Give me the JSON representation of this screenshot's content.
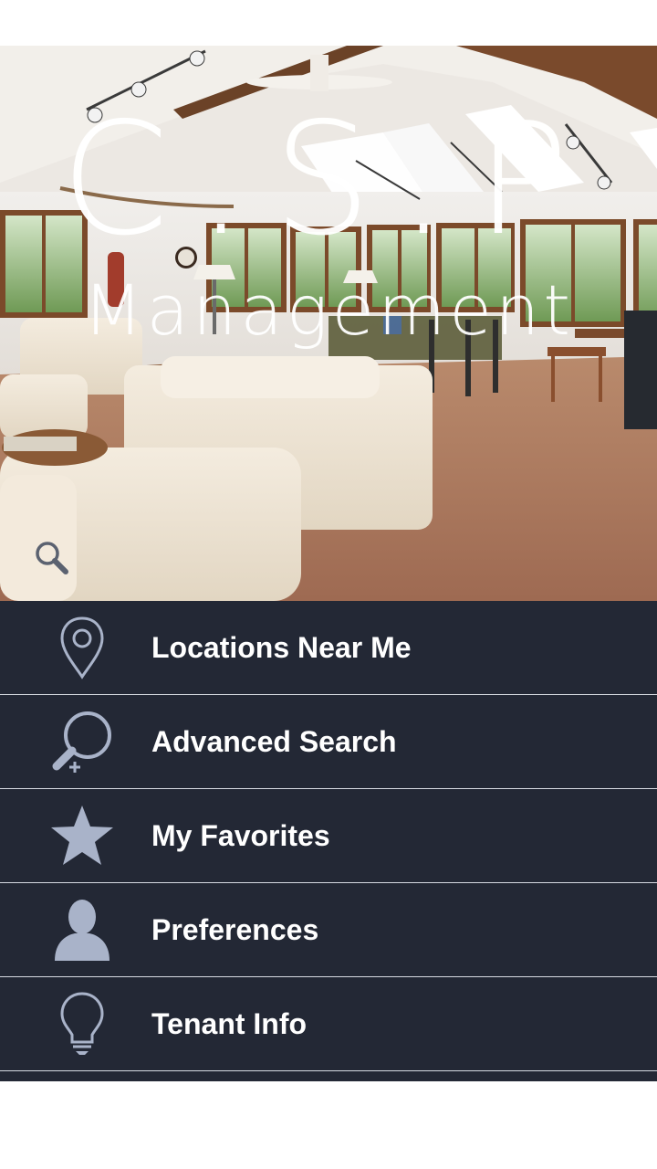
{
  "app": {
    "logo_mark": "C.S.P",
    "logo_subtitle": "Management"
  },
  "hero": {
    "search_icon": "search-icon"
  },
  "menu": {
    "items": [
      {
        "label": "Locations Near Me",
        "icon": "location-pin-icon"
      },
      {
        "label": "Advanced Search",
        "icon": "advanced-search-icon"
      },
      {
        "label": "My Favorites",
        "icon": "star-icon"
      },
      {
        "label": "Preferences",
        "icon": "user-icon"
      },
      {
        "label": "Tenant Info",
        "icon": "lightbulb-icon"
      }
    ]
  },
  "colors": {
    "menu_background": "#232835",
    "menu_divider": "#d7dbe2",
    "icon_color": "#a9b3c9",
    "label_color": "#ffffff"
  }
}
